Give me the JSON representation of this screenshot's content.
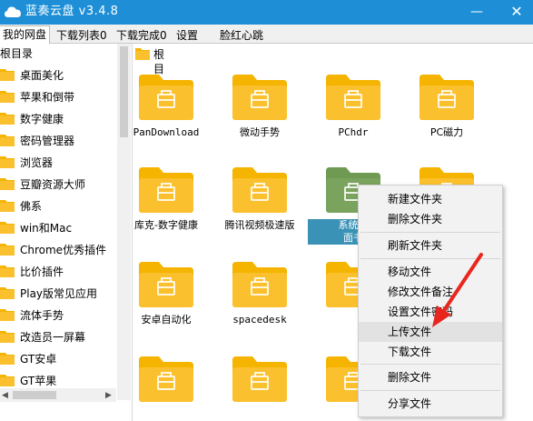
{
  "window": {
    "title": "蓝奏云盘 v3.4.8",
    "minimize_glyph": "—",
    "close_glyph": "✕"
  },
  "tabs": [
    {
      "label": "我的网盘",
      "active": true
    },
    {
      "label": "下载列表0"
    },
    {
      "label": "下载完成0"
    },
    {
      "label": "设置"
    },
    {
      "label": "脸红心跳"
    }
  ],
  "sidebar": {
    "root_label": "根目录",
    "items": [
      "桌面美化",
      "苹果和倒带",
      "数字健康",
      "密码管理器",
      "浏览器",
      "豆瓣资源大师",
      "佛系",
      "win和Mac",
      "Chrome优秀插件",
      "比价插件",
      "Play版常见应用",
      "流体手势",
      "改造员一屏幕",
      "GT安卓",
      "GT苹果"
    ]
  },
  "breadcrumb": {
    "label": "根目录"
  },
  "grid": {
    "tiles": [
      {
        "label": "PanDownload"
      },
      {
        "label": "微动手势"
      },
      {
        "label": "PChdr"
      },
      {
        "label": "PC磁力"
      },
      {
        "label": "库克-数字健康"
      },
      {
        "label": "腾讯视频极速版"
      },
      {
        "label": "系统对"
      },
      {
        "label": ""
      },
      {
        "label": "安卓自动化"
      },
      {
        "label": "spacedesk"
      },
      {
        "label": ""
      },
      {
        "label": ""
      },
      {
        "label": ""
      },
      {
        "label": ""
      },
      {
        "label": ""
      }
    ],
    "selected_caption_line2": "面书"
  },
  "context_menu": {
    "items": [
      "新建文件夹",
      "删除文件夹",
      "刷新文件夹",
      "移动文件",
      "修改文件备注",
      "设置文件密码",
      "上传文件",
      "下载文件",
      "删除文件",
      "分享文件"
    ],
    "highlighted": "上传文件"
  },
  "colors": {
    "titlebar": "#1e8fd6",
    "folder_yellow": "#fbc02d",
    "folder_yellow_dark": "#f4b400",
    "folder_green": "#7aa35e",
    "arrow_red": "#e8261e"
  },
  "scroll_arrows": {
    "up": "▲",
    "down": "▼",
    "left": "◀",
    "right": "▶"
  }
}
